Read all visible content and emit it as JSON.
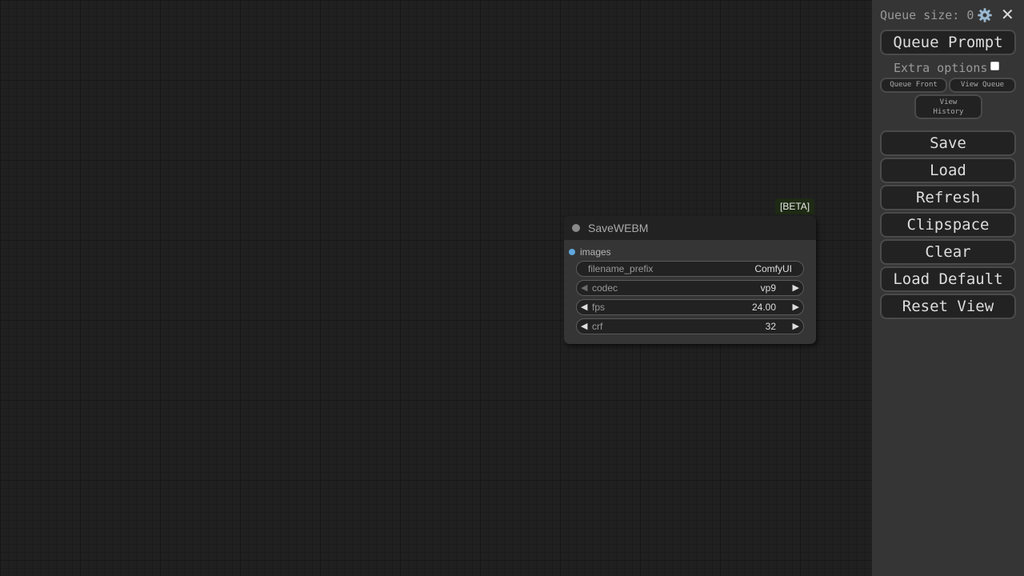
{
  "node": {
    "badge": "[BETA]",
    "title": "SaveWEBM",
    "input_slot": "images",
    "widgets": {
      "filename_prefix": {
        "name": "filename_prefix",
        "value": "ComfyUI"
      },
      "codec": {
        "name": "codec",
        "value": "vp9"
      },
      "fps": {
        "name": "fps",
        "value": "24.00"
      },
      "crf": {
        "name": "crf",
        "value": "32"
      }
    }
  },
  "menu": {
    "queue_size_label": "Queue size: 0",
    "queue_prompt": "Queue Prompt",
    "extra_options": "Extra options",
    "queue_front": "Queue Front",
    "view_queue": "View Queue",
    "view_history_line1": "View",
    "view_history_line2": "History",
    "save": "Save",
    "load": "Load",
    "refresh": "Refresh",
    "clipspace": "Clipspace",
    "clear": "Clear",
    "load_default": "Load Default",
    "reset_view": "Reset View"
  },
  "icons": {
    "settings": "gear-icon",
    "close": "close-icon",
    "left_arrow": "◀",
    "right_arrow": "▶"
  },
  "colors": {
    "canvas_bg": "#202020",
    "menu_bg": "#353535",
    "node_bg": "#353535",
    "slot_color": "#5fa8e0"
  }
}
